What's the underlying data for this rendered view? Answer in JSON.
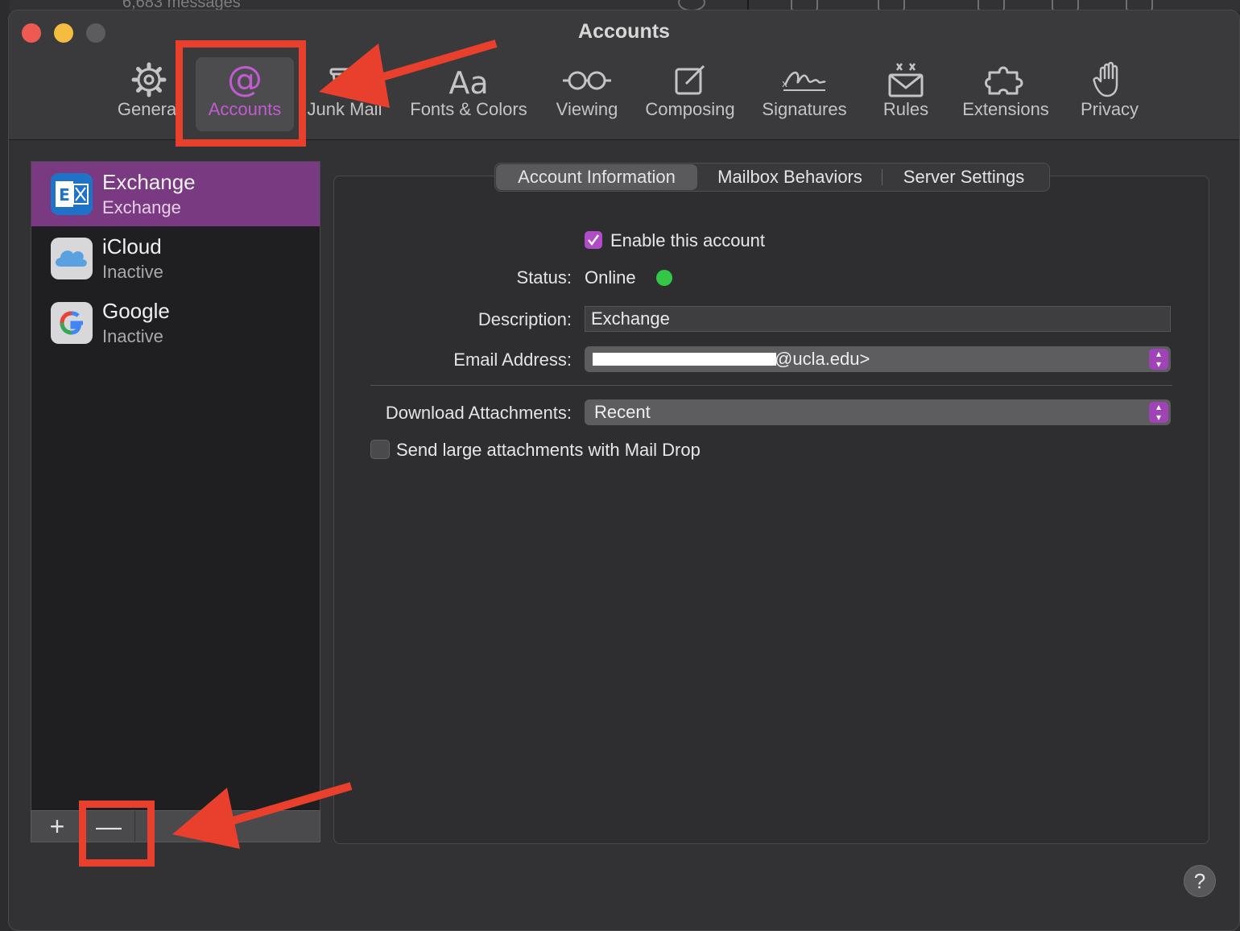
{
  "background": {
    "message_count": "6,683 messages"
  },
  "window": {
    "title": "Accounts"
  },
  "toolbar": {
    "items": [
      {
        "label": "General",
        "icon": "gear-icon"
      },
      {
        "label": "Accounts",
        "icon": "at-sign-icon"
      },
      {
        "label": "Junk Mail",
        "icon": "junk-mail-icon"
      },
      {
        "label": "Fonts & Colors",
        "icon": "fonts-icon"
      },
      {
        "label": "Viewing",
        "icon": "glasses-icon"
      },
      {
        "label": "Composing",
        "icon": "compose-icon"
      },
      {
        "label": "Signatures",
        "icon": "signature-icon"
      },
      {
        "label": "Rules",
        "icon": "rules-icon"
      },
      {
        "label": "Extensions",
        "icon": "puzzle-icon"
      },
      {
        "label": "Privacy",
        "icon": "hand-icon"
      }
    ],
    "accent": "#c15bd0"
  },
  "accounts": [
    {
      "name": "Exchange",
      "status": "Exchange",
      "icon": "exchange-icon",
      "selected": true
    },
    {
      "name": "iCloud",
      "status": "Inactive",
      "icon": "icloud-icon",
      "selected": false
    },
    {
      "name": "Google",
      "status": "Inactive",
      "icon": "google-icon",
      "selected": false
    }
  ],
  "sidebar_buttons": {
    "add": "+",
    "remove": "—"
  },
  "tabs": [
    {
      "label": "Account Information",
      "active": true
    },
    {
      "label": "Mailbox Behaviors",
      "active": false
    },
    {
      "label": "Server Settings",
      "active": false
    }
  ],
  "form": {
    "enable_label": "Enable this account",
    "enable_checked": true,
    "status_label": "Status:",
    "status_value": "Online",
    "status_color": "#33c748",
    "description_label": "Description:",
    "description_value": "Exchange",
    "email_label": "Email Address:",
    "email_value": "@ucla.edu>",
    "download_label": "Download Attachments:",
    "download_value": "Recent",
    "maildrop_label": "Send large attachments with Mail Drop",
    "maildrop_checked": false
  },
  "help": "?",
  "annotation_color": "#e8402c"
}
